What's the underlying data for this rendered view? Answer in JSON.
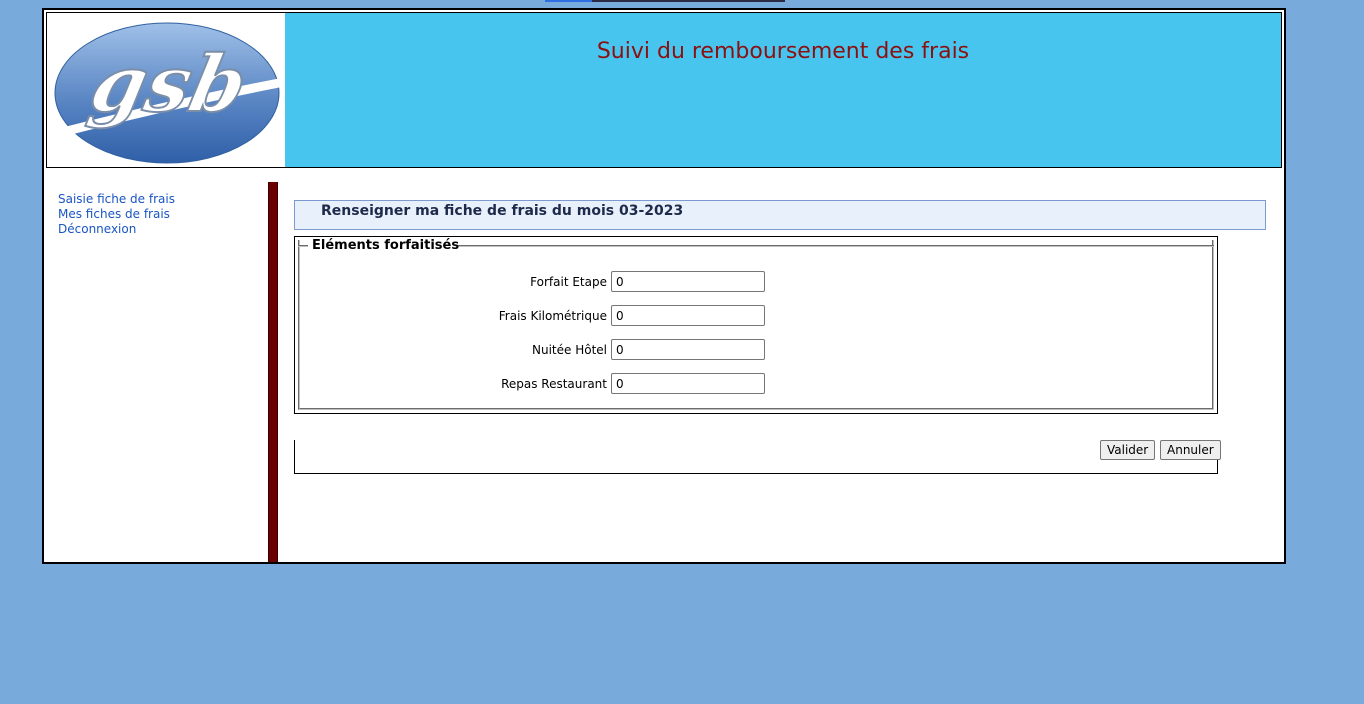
{
  "header": {
    "logo_text": "gsb",
    "title": "Suivi du remboursement des frais"
  },
  "menu": {
    "items": [
      {
        "label": "Saisie fiche de frais"
      },
      {
        "label": "Mes fiches de frais"
      },
      {
        "label": "Déconnexion"
      }
    ]
  },
  "main": {
    "heading": "Renseigner ma fiche de frais du mois 03-2023",
    "fieldset_legend": "Eléments forfaitisés",
    "fields": [
      {
        "label": "Forfait Etape",
        "value": "0"
      },
      {
        "label": "Frais Kilométrique",
        "value": "0"
      },
      {
        "label": "Nuitée Hôtel",
        "value": "0"
      },
      {
        "label": "Repas Restaurant",
        "value": "0"
      }
    ],
    "buttons": {
      "submit": "Valider",
      "reset": "Annuler"
    }
  },
  "colors": {
    "background": "#78aadc",
    "header_bg": "#48c5ef",
    "title": "#8b1010",
    "menu_link": "#1a55c2",
    "separator": "#6b0000"
  }
}
